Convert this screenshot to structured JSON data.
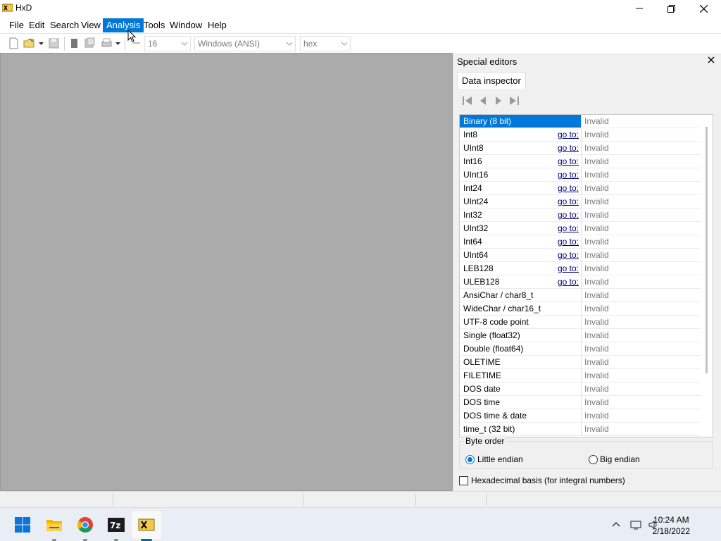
{
  "window": {
    "title": "HxD"
  },
  "menu": [
    "File",
    "Edit",
    "Search",
    "View",
    "Analysis",
    "Tools",
    "Window",
    "Help"
  ],
  "toolbar": {
    "bytes_per_row": "16",
    "charset": "Windows (ANSI)",
    "offset_base": "hex"
  },
  "panel": {
    "title": "Special editors",
    "tab": "Data inspector",
    "goto_label": "go to:",
    "rows": [
      {
        "name": "Binary (8 bit)",
        "value": "Invalid",
        "goto": false,
        "selected": true
      },
      {
        "name": "Int8",
        "value": "Invalid",
        "goto": true
      },
      {
        "name": "UInt8",
        "value": "Invalid",
        "goto": true
      },
      {
        "name": "Int16",
        "value": "Invalid",
        "goto": true
      },
      {
        "name": "UInt16",
        "value": "Invalid",
        "goto": true
      },
      {
        "name": "Int24",
        "value": "Invalid",
        "goto": true
      },
      {
        "name": "UInt24",
        "value": "Invalid",
        "goto": true
      },
      {
        "name": "Int32",
        "value": "Invalid",
        "goto": true
      },
      {
        "name": "UInt32",
        "value": "Invalid",
        "goto": true
      },
      {
        "name": "Int64",
        "value": "Invalid",
        "goto": true
      },
      {
        "name": "UInt64",
        "value": "Invalid",
        "goto": true
      },
      {
        "name": "LEB128",
        "value": "Invalid",
        "goto": true
      },
      {
        "name": "ULEB128",
        "value": "Invalid",
        "goto": true
      },
      {
        "name": "AnsiChar / char8_t",
        "value": "Invalid",
        "goto": false
      },
      {
        "name": "WideChar / char16_t",
        "value": "Invalid",
        "goto": false
      },
      {
        "name": "UTF-8 code point",
        "value": "Invalid",
        "goto": false
      },
      {
        "name": "Single (float32)",
        "value": "Invalid",
        "goto": false
      },
      {
        "name": "Double (float64)",
        "value": "Invalid",
        "goto": false
      },
      {
        "name": "OLETIME",
        "value": "Invalid",
        "goto": false
      },
      {
        "name": "FILETIME",
        "value": "Invalid",
        "goto": false
      },
      {
        "name": "DOS date",
        "value": "Invalid",
        "goto": false
      },
      {
        "name": "DOS time",
        "value": "Invalid",
        "goto": false
      },
      {
        "name": "DOS time & date",
        "value": "Invalid",
        "goto": false
      },
      {
        "name": "time_t (32 bit)",
        "value": "Invalid",
        "goto": false
      }
    ],
    "byte_order": {
      "label": "Byte order",
      "little": "Little endian",
      "big": "Big endian",
      "selected": "little"
    },
    "hex_basis": {
      "label": "Hexadecimal basis (for integral numbers)",
      "checked": false
    }
  },
  "taskbar": {
    "apps": [
      "start-icon",
      "file-explorer-icon",
      "chrome-icon",
      "7zip-icon",
      "hxd-icon"
    ],
    "time": "10:24 AM",
    "date": "2/18/2022"
  },
  "colors": {
    "accent": "#0078d7",
    "workarea": "#ababab",
    "link": "#000080"
  }
}
